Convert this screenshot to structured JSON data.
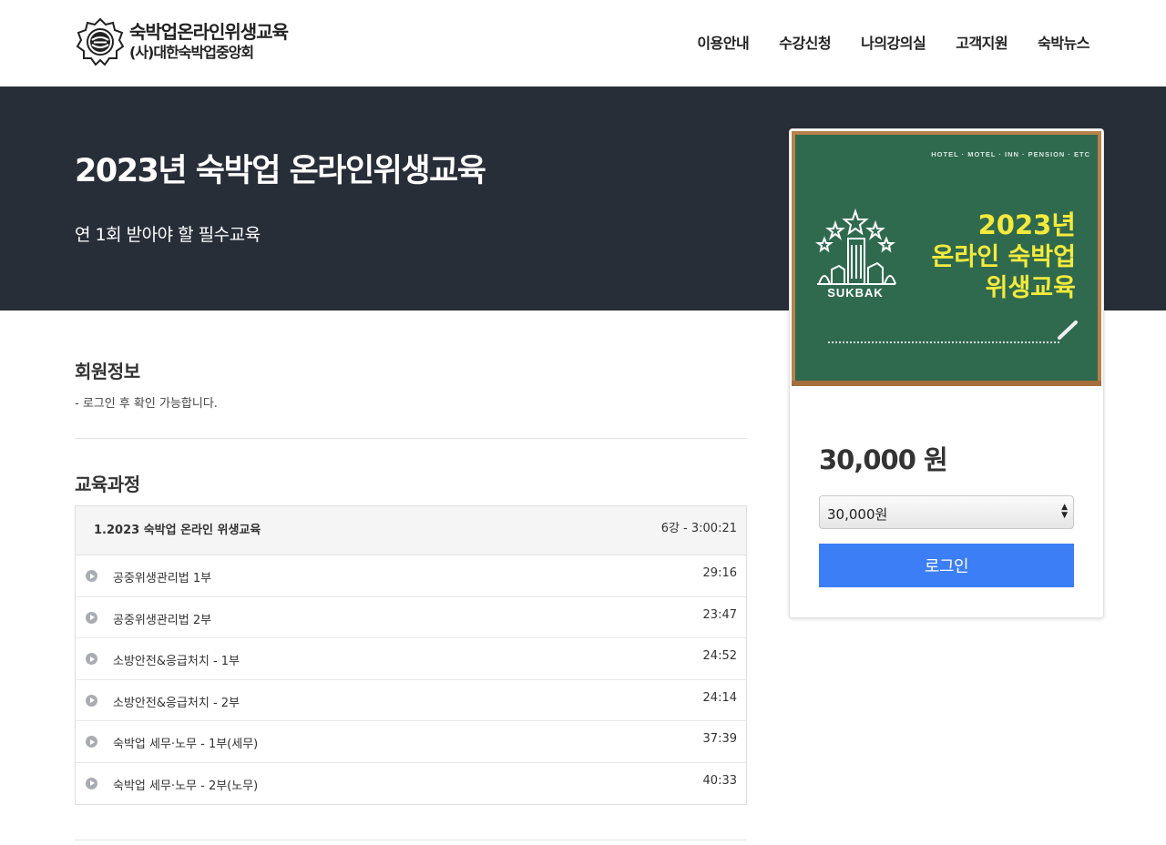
{
  "header": {
    "logo_title": "숙박업온라인위생교육",
    "logo_subtitle": "(사)대한숙박업중앙회",
    "nav": [
      {
        "label": "이용안내"
      },
      {
        "label": "수강신청"
      },
      {
        "label": "나의강의실"
      },
      {
        "label": "고객지원"
      },
      {
        "label": "숙박뉴스"
      }
    ]
  },
  "hero": {
    "title": "2023년 숙박업 온라인위생교육",
    "subtitle": "연 1회 받아야 할 필수교육"
  },
  "member_info": {
    "title": "회원정보",
    "note": "- 로그인 후 확인 가능합니다."
  },
  "curriculum": {
    "title": "교육과정",
    "course_title": "1.2023 숙박업 온라인 위생교육",
    "course_meta": "6강 - 3:00:21",
    "lessons": [
      {
        "title": "공중위생관리법 1부",
        "duration": "29:16"
      },
      {
        "title": "공중위생관리법 2부",
        "duration": "23:47"
      },
      {
        "title": "소방안전&응급처치 - 1부",
        "duration": "24:52"
      },
      {
        "title": "소방안전&응급처치 - 2부",
        "duration": "24:14"
      },
      {
        "title": "숙박업 세무·노무 - 1부(세무)",
        "duration": "37:39"
      },
      {
        "title": "숙박업 세무·노무 - 2부(노무)",
        "duration": "40:33"
      }
    ]
  },
  "side_card": {
    "thumbnail": {
      "top_caption": "HOTEL · MOTEL · INN · PENSION · ETC",
      "brand": "SUKBAK",
      "line1": "2023년",
      "line2": "온라인 숙박업",
      "line3": "위생교육"
    },
    "price": "30,000 원",
    "select_value": "30,000원",
    "login_label": "로그인"
  },
  "colors": {
    "hero_bg": "#282e38",
    "button": "#3b7ef5",
    "chalkboard": "#2f6a4f",
    "chalk_text": "#f5ea3c"
  }
}
